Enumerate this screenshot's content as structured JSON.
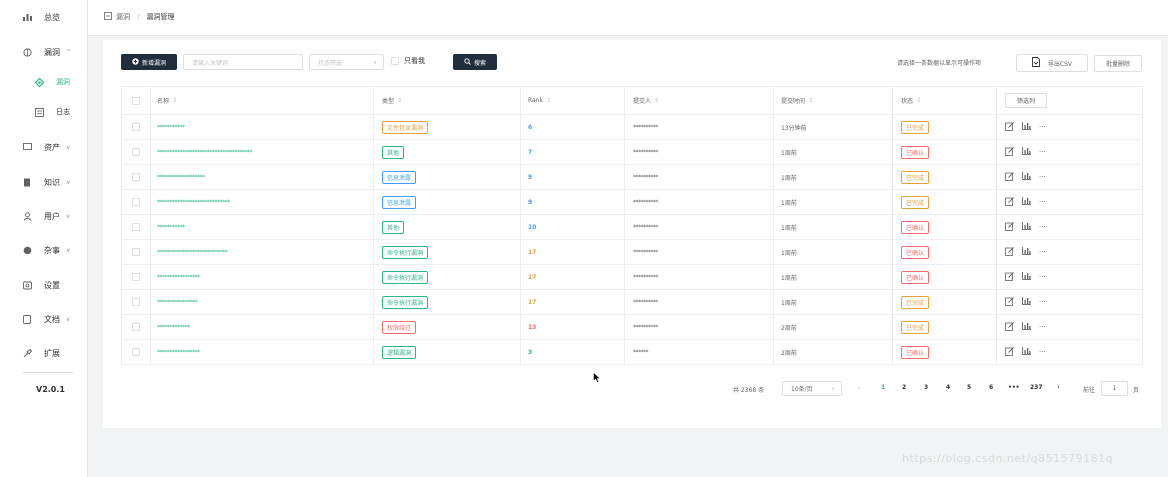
{
  "sidebar": {
    "items": [
      {
        "label": "总览",
        "icon": "chart-icon",
        "chev": ""
      },
      {
        "label": "漏洞",
        "icon": "bug-icon",
        "chev": "^"
      },
      {
        "label": "漏洞",
        "icon": "shield-icon",
        "chev": "",
        "sub": true,
        "active": true
      },
      {
        "label": "日志",
        "icon": "log-icon",
        "chev": "",
        "sub": true
      },
      {
        "label": "资产",
        "icon": "monitor-icon",
        "chev": "v"
      },
      {
        "label": "知识",
        "icon": "book-icon",
        "chev": "v"
      },
      {
        "label": "用户",
        "icon": "user-icon",
        "chev": "v"
      },
      {
        "label": "杂事",
        "icon": "misc-icon",
        "chev": "v"
      },
      {
        "label": "设置",
        "icon": "settings-icon",
        "chev": ""
      },
      {
        "label": "文档",
        "icon": "doc-icon",
        "chev": "v"
      },
      {
        "label": "扩展",
        "icon": "plugin-icon",
        "chev": ""
      }
    ],
    "version": "V2.0.1"
  },
  "breadcrumb": {
    "root": "漏洞",
    "current": "漏洞管理"
  },
  "toolbar": {
    "new_label": "新增漏洞",
    "keyword_placeholder": "请输入关键词",
    "status_placeholder": "状态筛选",
    "only_mine": "只看我",
    "search_label": "搜索",
    "hint": "请选择一条数据以显示可操作项",
    "export_label": "导出CSV",
    "batch_delete": "批量删除"
  },
  "table": {
    "headers": {
      "name": "名称",
      "type": "类型",
      "rank": "Rank",
      "submitter": "提交人",
      "time": "提交时间",
      "status": "状态",
      "filter": "筛选列"
    },
    "rows": [
      {
        "name": "***********",
        "type": "文件包含漏洞",
        "type_color": "#e6a23c",
        "rank": "6",
        "rank_color": "#409eff",
        "submitter": "**********",
        "time": "13分钟前",
        "status": "已完成",
        "status_color": "#e6a23c"
      },
      {
        "name": "**************************************",
        "type": "其他",
        "type_color": "#2db58a",
        "rank": "7",
        "rank_color": "#409eff",
        "submitter": "**********",
        "time": "1周前",
        "status": "已确认",
        "status_color": "#f56c6c"
      },
      {
        "name": "*******************",
        "type": "信息泄露",
        "type_color": "#409eff",
        "rank": "9",
        "rank_color": "#409eff",
        "submitter": "**********",
        "time": "1周前",
        "status": "已完成",
        "status_color": "#e6a23c"
      },
      {
        "name": "*****************************",
        "type": "信息泄露",
        "type_color": "#409eff",
        "rank": "9",
        "rank_color": "#409eff",
        "submitter": "**********",
        "time": "1周前",
        "status": "已完成",
        "status_color": "#e6a23c"
      },
      {
        "name": "***********",
        "type": "其他",
        "type_color": "#2db58a",
        "rank": "10",
        "rank_color": "#409eff",
        "submitter": "**********",
        "time": "1周前",
        "status": "已确认",
        "status_color": "#f56c6c"
      },
      {
        "name": "****************************",
        "type": "命令执行漏洞",
        "type_color": "#2db58a",
        "rank": "17",
        "rank_color": "#e6a23c",
        "submitter": "**********",
        "time": "1周前",
        "status": "已确认",
        "status_color": "#f56c6c"
      },
      {
        "name": "*****************",
        "type": "命令执行漏洞",
        "type_color": "#2db58a",
        "rank": "17",
        "rank_color": "#e6a23c",
        "submitter": "**********",
        "time": "1周前",
        "status": "已确认",
        "status_color": "#f56c6c"
      },
      {
        "name": "****************",
        "type": "命令执行漏洞",
        "type_color": "#2db58a",
        "rank": "17",
        "rank_color": "#e6a23c",
        "submitter": "**********",
        "time": "1周前",
        "status": "已完成",
        "status_color": "#e6a23c"
      },
      {
        "name": "*************",
        "type": "权限绕过",
        "type_color": "#f56c6c",
        "rank": "13",
        "rank_color": "#f56c6c",
        "submitter": "**********",
        "time": "2周前",
        "status": "已完成",
        "status_color": "#e6a23c"
      },
      {
        "name": "*****************",
        "type": "逻辑漏洞",
        "type_color": "#2db58a",
        "rank": "3",
        "rank_color": "#2db58a",
        "submitter": "******",
        "time": "2周前",
        "status": "已确认",
        "status_color": "#f56c6c"
      }
    ]
  },
  "pagination": {
    "total": "共 2368 条",
    "page_size": "10条/页",
    "pages": [
      "1",
      "2",
      "3",
      "4",
      "5",
      "6",
      "•••",
      "237"
    ],
    "goto_label": "前往",
    "goto_value": "1",
    "page_suffix": "页"
  },
  "watermark": "https://blog.csdn.net/q851579181q"
}
